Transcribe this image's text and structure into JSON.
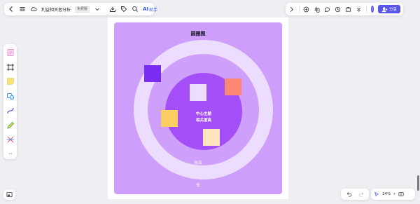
{
  "header": {
    "doc_title": "利益相关者分析",
    "doc_tag": "免费版",
    "ai_mark": "AI",
    "ai_label": "助手",
    "share_label": "分享",
    "avatar_initial": "I"
  },
  "diagram": {
    "title": "圆圈图",
    "center_line1": "中心主题",
    "center_line2": "相关度高",
    "mid_label": "较高",
    "outer_label": "低"
  },
  "zoom": {
    "value": "34%"
  },
  "colors": {
    "board": "#ce9efc",
    "ring_outer": "#ecdcfd",
    "ring_middle": "#cfa0fb",
    "ring_inner": "#a34ef6",
    "accent": "#5a55ea",
    "sticky_purple": "#7b2cf2",
    "sticky_light": "#ecdcfd",
    "sticky_orange": "#fb8774",
    "sticky_yellow": "#fbce62",
    "sticky_cream": "#fde5bd"
  }
}
